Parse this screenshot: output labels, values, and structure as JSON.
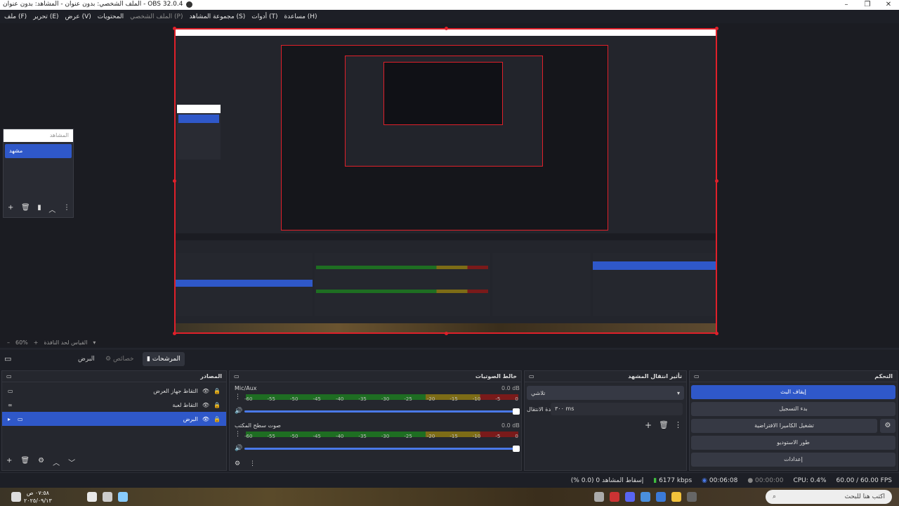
{
  "window": {
    "title": "OBS 32.0.4 - الملف الشخصي: بدون عنوان - المشاهد: بدون عنوان",
    "controls": {
      "minimize": "–",
      "maximize": "❐",
      "close": "✕"
    }
  },
  "menu": {
    "items": [
      {
        "label": "ملف (F)"
      },
      {
        "label": "تحرير (E)"
      },
      {
        "label": "عرض (V)"
      },
      {
        "label": "المحتويات"
      },
      {
        "label": "الملف الشخصي (P)",
        "dim": true
      },
      {
        "label": "مجموعة المشاهد (S)"
      },
      {
        "label": "أدوات (T)"
      },
      {
        "label": "مساعدة (H)"
      }
    ]
  },
  "scenes_float": {
    "header": "المشاهد",
    "item": "مشهد",
    "tools": {
      "add": "+",
      "remove": "🗑",
      "filters": "▮",
      "up": "︿",
      "more": "⋮"
    }
  },
  "zoom": {
    "value": "60%",
    "hint": "القياس لحد النافذة"
  },
  "dock_tabs": {
    "sources": "المرشحات",
    "properties": "خصائص",
    "bg": "البرض"
  },
  "sources_panel": {
    "title": "المصادر",
    "items": [
      {
        "label": "التقاط جهاز العرض",
        "icon": "monitor-icon",
        "selected": false
      },
      {
        "label": "التقاط لعبة",
        "icon": "gamepad-icon",
        "selected": false
      },
      {
        "label": "البرض",
        "icon": "folder-icon",
        "selected": true
      }
    ]
  },
  "mixer_panel": {
    "title": "خالط الصوتيات",
    "channels": [
      {
        "name": "Mic/Aux",
        "db": "0.0 dB"
      },
      {
        "name": "صوت سطح المكتب",
        "db": "0.0 dB"
      }
    ],
    "ticks": [
      "-60",
      "-55",
      "-50",
      "-45",
      "-40",
      "-35",
      "-30",
      "-25",
      "-20",
      "-15",
      "-10",
      "-5",
      "0"
    ]
  },
  "transitions_panel": {
    "title": "تأثير انتقال المشهد",
    "selected": "تلاشي",
    "duration_label": "مدة الانتقال",
    "duration_value": "٣٠٠ ms"
  },
  "controls_panel": {
    "title": "التحكم",
    "buttons": [
      {
        "label": "إيقاف البث",
        "primary": true
      },
      {
        "label": "بدء التسجيل",
        "primary": false
      },
      {
        "label": "تشغيل الكاميرا الافتراضية",
        "primary": false
      },
      {
        "label": "طور الاستوديو",
        "primary": false
      },
      {
        "label": "إعدادات",
        "primary": false
      }
    ]
  },
  "status": {
    "dropped": "إسقاط المشاهد 0 (0.0 %)",
    "bitrate": "6177 kbps",
    "stream_time": "00:06:08",
    "rec_time": "00:00:00",
    "cpu": "CPU: 0.4%",
    "fps": "60.00 / 60.00 FPS"
  },
  "taskbar": {
    "search_placeholder": "اكتب هنا للبحث",
    "time": "٠٧:٥٨ ص",
    "date": "٢٠٢٥/٠٩/١٣"
  },
  "colors": {
    "accent": "#2f58c9",
    "capture_border": "#e0202a",
    "meter_green": "#1e6e22",
    "meter_yellow": "#7d6c16",
    "meter_red": "#7a1a1a"
  }
}
